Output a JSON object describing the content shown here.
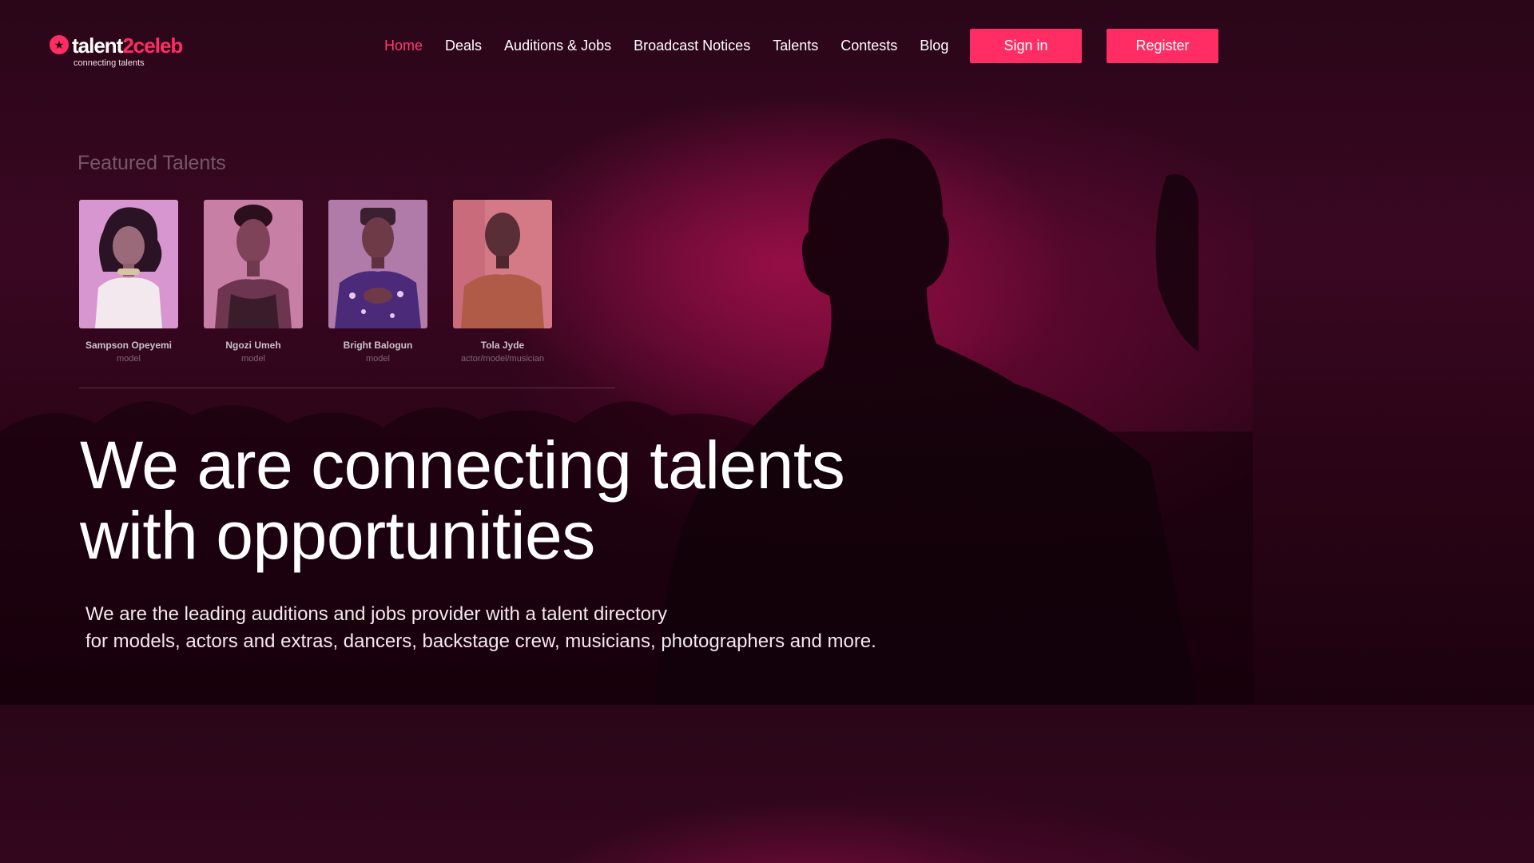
{
  "brand": {
    "name_main": "talent",
    "name_accent": "2celeb",
    "tagline": "connecting talents",
    "accent_color": "#ff2d63"
  },
  "nav": {
    "items": [
      {
        "label": "Home",
        "active": true
      },
      {
        "label": "Deals"
      },
      {
        "label": "Auditions & Jobs"
      },
      {
        "label": "Broadcast Notices"
      },
      {
        "label": "Talents"
      },
      {
        "label": "Contests"
      },
      {
        "label": "Blog"
      }
    ],
    "signin_label": "Sign in",
    "register_label": "Register"
  },
  "featured": {
    "title": "Featured Talents",
    "talents": [
      {
        "name": "Sampson Opeyemi",
        "role": "model"
      },
      {
        "name": "Ngozi Umeh",
        "role": "model"
      },
      {
        "name": "Bright Balogun",
        "role": "model"
      },
      {
        "name": "Tola Jyde",
        "role": "actor/model/musician"
      }
    ]
  },
  "hero": {
    "title_line1": "We are connecting talents",
    "title_line2": "with opportunities",
    "subtitle_line1": "We are the leading auditions and jobs provider with a talent directory",
    "subtitle_line2": "for models, actors and extras, dancers, backstage crew, musicians, photographers and more."
  }
}
